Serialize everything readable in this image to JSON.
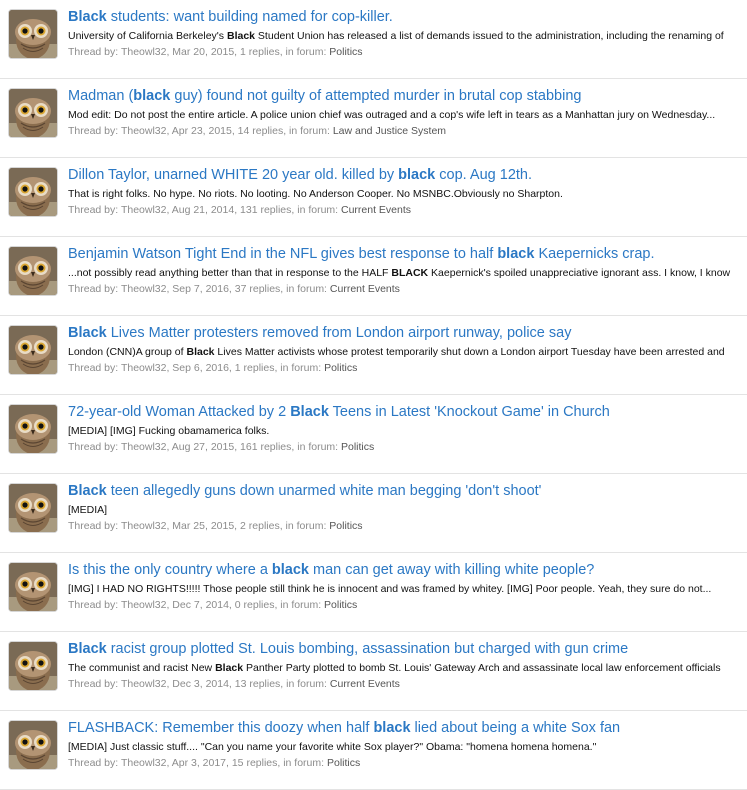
{
  "results": [
    {
      "title": [
        {
          "t": "Black",
          "b": true
        },
        {
          "t": " students: want building named for cop-killer.",
          "b": false
        }
      ],
      "snippet": [
        {
          "t": "University of California Berkeley's ",
          "b": false
        },
        {
          "t": "Black",
          "b": true
        },
        {
          "t": " Student Union has released a list of demands issued to the administration, including the renaming of",
          "b": false
        }
      ],
      "thread_by": "Thread by:",
      "author": "Theowl32",
      "info": ", Mar 20, 2015, 1 replies, in forum: ",
      "forum": "Politics"
    },
    {
      "title": [
        {
          "t": "Madman (",
          "b": false
        },
        {
          "t": "black",
          "b": true
        },
        {
          "t": " guy) found not guilty of attempted murder in brutal cop stabbing",
          "b": false
        }
      ],
      "snippet": [
        {
          "t": "Mod edit: Do not post the entire article. A police union chief was outraged and a cop's wife left in tears as a Manhattan jury on Wednesday...",
          "b": false
        }
      ],
      "thread_by": "Thread by:",
      "author": "Theowl32",
      "info": ", Apr 23, 2015, 14 replies, in forum: ",
      "forum": "Law and Justice System"
    },
    {
      "title": [
        {
          "t": "Dillon Taylor, unarned WHITE 20 year old. killed by ",
          "b": false
        },
        {
          "t": "black",
          "b": true
        },
        {
          "t": " cop. Aug 12th.",
          "b": false
        }
      ],
      "snippet": [
        {
          "t": "That is right folks. No hype. No riots. No looting. No Anderson Cooper. No MSNBC.Obviously no Sharpton.",
          "b": false
        }
      ],
      "thread_by": "Thread by:",
      "author": "Theowl32",
      "info": ", Aug 21, 2014, 131 replies, in forum: ",
      "forum": "Current Events"
    },
    {
      "title": [
        {
          "t": "Benjamin Watson Tight End in the NFL gives best response to half ",
          "b": false
        },
        {
          "t": "black",
          "b": true
        },
        {
          "t": " Kaepernicks crap.",
          "b": false
        }
      ],
      "snippet": [
        {
          "t": "...not possibly read anything better than that in response to the HALF ",
          "b": false
        },
        {
          "t": "BLACK",
          "b": true
        },
        {
          "t": " Kaepernick's spoiled unappreciative ignorant ass. I know, I know",
          "b": false
        }
      ],
      "thread_by": "Thread by:",
      "author": "Theowl32",
      "info": ", Sep 7, 2016, 37 replies, in forum: ",
      "forum": "Current Events"
    },
    {
      "title": [
        {
          "t": "Black",
          "b": true
        },
        {
          "t": " Lives Matter protesters removed from London airport runway, police say",
          "b": false
        }
      ],
      "snippet": [
        {
          "t": "London (CNN)A group of ",
          "b": false
        },
        {
          "t": "Black",
          "b": true
        },
        {
          "t": " Lives Matter activists whose protest temporarily shut down a London airport Tuesday have been arrested and",
          "b": false
        }
      ],
      "thread_by": "Thread by:",
      "author": "Theowl32",
      "info": ", Sep 6, 2016, 1 replies, in forum: ",
      "forum": "Politics"
    },
    {
      "title": [
        {
          "t": "72-year-old Woman Attacked by 2 ",
          "b": false
        },
        {
          "t": "Black",
          "b": true
        },
        {
          "t": " Teens in Latest 'Knockout Game' in Church",
          "b": false
        }
      ],
      "snippet": [
        {
          "t": "[MEDIA] [IMG] Fucking obamamerica folks.",
          "b": false
        }
      ],
      "thread_by": "Thread by:",
      "author": "Theowl32",
      "info": ", Aug 27, 2015, 161 replies, in forum: ",
      "forum": "Politics"
    },
    {
      "title": [
        {
          "t": "Black",
          "b": true
        },
        {
          "t": " teen allegedly guns down unarmed white man begging 'don't shoot'",
          "b": false
        }
      ],
      "snippet": [
        {
          "t": "[MEDIA]",
          "b": false
        }
      ],
      "thread_by": "Thread by:",
      "author": "Theowl32",
      "info": ", Mar 25, 2015, 2 replies, in forum: ",
      "forum": "Politics"
    },
    {
      "title": [
        {
          "t": "Is this the only country where a ",
          "b": false
        },
        {
          "t": "black",
          "b": true
        },
        {
          "t": " man can get away with killing white people?",
          "b": false
        }
      ],
      "snippet": [
        {
          "t": "[IMG] I HAD NO RIGHTS!!!!! Those people still think he is innocent and was framed by whitey. [IMG] Poor people. Yeah, they sure do not...",
          "b": false
        }
      ],
      "thread_by": "Thread by:",
      "author": "Theowl32",
      "info": ", Dec 7, 2014, 0 replies, in forum: ",
      "forum": "Politics"
    },
    {
      "title": [
        {
          "t": "Black",
          "b": true
        },
        {
          "t": " racist group plotted St. Louis bombing, assassination but charged with gun crime",
          "b": false
        }
      ],
      "snippet": [
        {
          "t": "The communist and racist New ",
          "b": false
        },
        {
          "t": "Black",
          "b": true
        },
        {
          "t": " Panther Party plotted to bomb St. Louis' Gateway Arch and assassinate local law enforcement officials",
          "b": false
        }
      ],
      "thread_by": "Thread by:",
      "author": "Theowl32",
      "info": ", Dec 3, 2014, 13 replies, in forum: ",
      "forum": "Current Events"
    },
    {
      "title": [
        {
          "t": "FLASHBACK: Remember this doozy when half ",
          "b": false
        },
        {
          "t": "black",
          "b": true
        },
        {
          "t": " lied about being a white Sox fan",
          "b": false
        }
      ],
      "snippet": [
        {
          "t": "[MEDIA] Just classic stuff.... \"Can you name your favorite white Sox player?\" Obama: \"homena homena homena.\"",
          "b": false
        }
      ],
      "thread_by": "Thread by:",
      "author": "Theowl32",
      "info": ", Apr 3, 2017, 15 replies, in forum: ",
      "forum": "Politics"
    }
  ]
}
